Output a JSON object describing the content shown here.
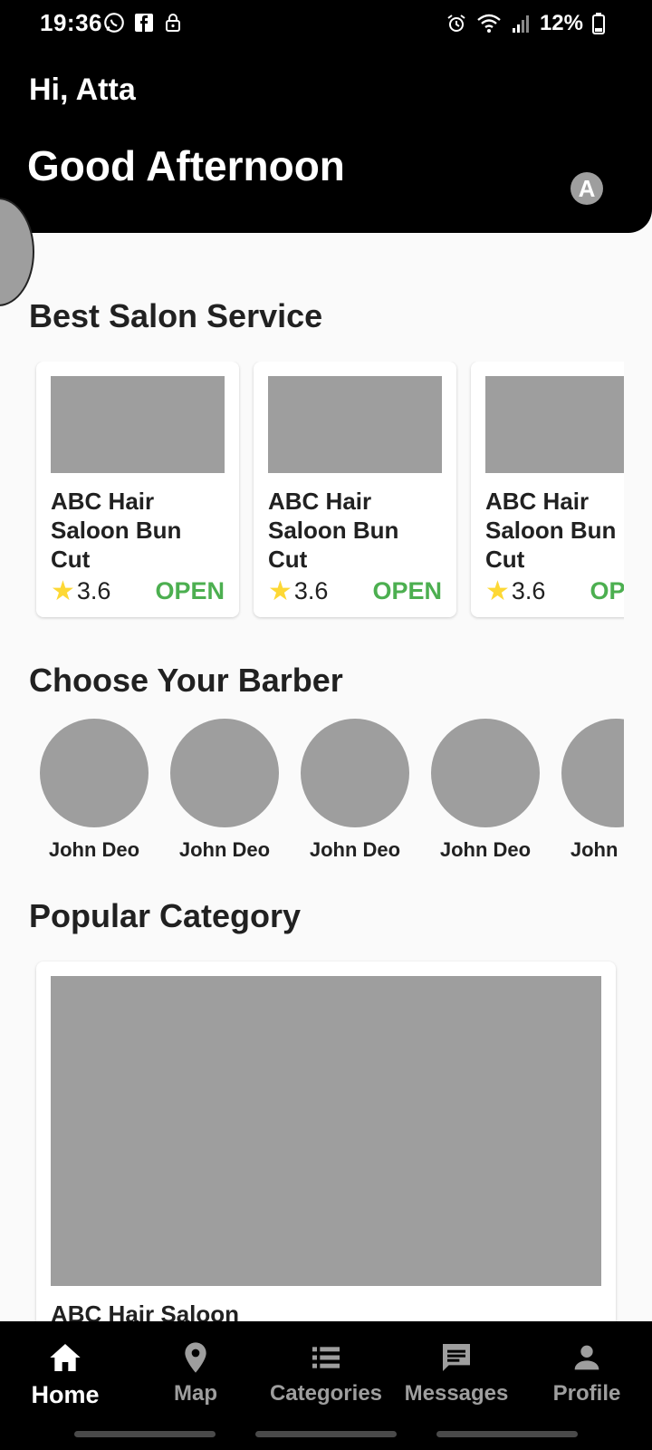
{
  "status_bar": {
    "time": "19:36",
    "battery": "12%"
  },
  "header": {
    "greeting": "Hi, Atta",
    "salutation": "Good Afternoon",
    "avatar_letter": "A"
  },
  "sections": {
    "best_salon": "Best Salon Service",
    "barbers": "Choose Your Barber",
    "category": "Popular Category"
  },
  "salons": [
    {
      "name": "ABC Hair Saloon Bun Cut",
      "rating": "3.6",
      "status": "OPEN"
    },
    {
      "name": "ABC Hair Saloon Bun Cut",
      "rating": "3.6",
      "status": "OPEN"
    },
    {
      "name": "ABC Hair Saloon Bun Cut",
      "rating": "3.6",
      "status": "OPEN"
    }
  ],
  "barbers": [
    {
      "name": "John Deo"
    },
    {
      "name": "John Deo"
    },
    {
      "name": "John Deo"
    },
    {
      "name": "John Deo"
    },
    {
      "name": "John Deo"
    }
  ],
  "categories": [
    {
      "name": "ABC Hair Saloon"
    }
  ],
  "bottom_nav": [
    {
      "label": "Home",
      "icon": "home-icon",
      "active": true
    },
    {
      "label": "Map",
      "icon": "map-pin-icon",
      "active": false
    },
    {
      "label": "Categories",
      "icon": "list-icon",
      "active": false
    },
    {
      "label": "Messages",
      "icon": "message-icon",
      "active": false
    },
    {
      "label": "Profile",
      "icon": "person-icon",
      "active": false
    }
  ],
  "colors": {
    "header_bg": "#000000",
    "open_status": "#4caf50",
    "star": "#fdd835",
    "placeholder": "#9e9e9e"
  }
}
